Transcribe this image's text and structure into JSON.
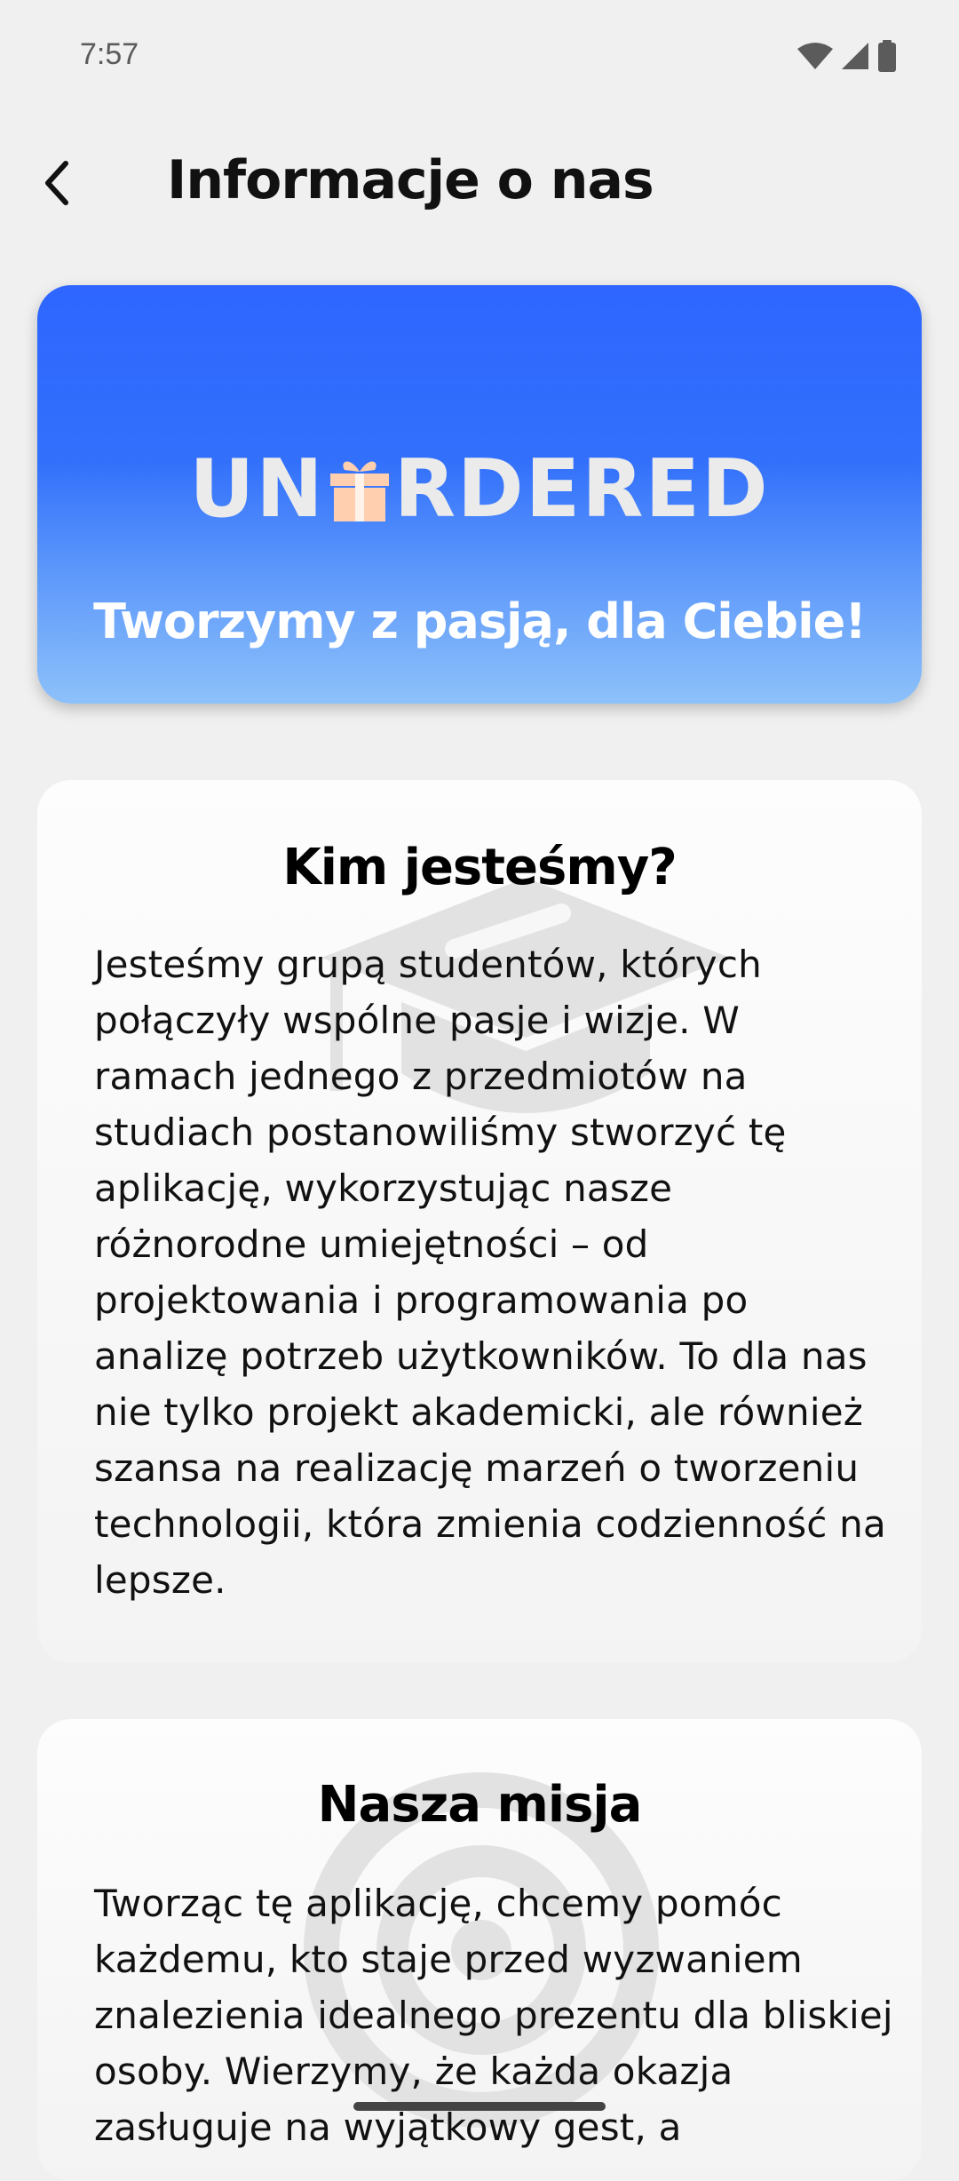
{
  "status_bar": {
    "time": "7:57",
    "icons": [
      "wifi-icon",
      "signal-icon",
      "battery-icon"
    ]
  },
  "app_bar": {
    "back_icon": "back-arrow-icon",
    "title": "Informacje o nas"
  },
  "hero": {
    "logo_text_left": "UN",
    "logo_text_right": "RDERED",
    "logo_icon": "gift-icon",
    "slogan": "Tworzymy z pasją, dla Ciebie!",
    "colors": {
      "gradient_top": "#2e66ff",
      "gradient_bottom": "#8dc1fa",
      "gift": "#ffcfb0"
    }
  },
  "sections": [
    {
      "title": "Kim jesteśmy?",
      "watermark_icon": "graduation-cap-icon",
      "body": "Jesteśmy grupą studentów, których połączyły wspólne pasje i wizje. W ramach jednego z przedmiotów na studiach postanowiliśmy stworzyć tę aplikację, wykorzystując nasze różnorodne umiejętności – od projektowania i programowania po analizę potrzeb użytkowników. To dla nas nie tylko projekt akademicki, ale również szansa na realizację marzeń o tworzeniu technologii, która zmienia codzienność na lepsze."
    },
    {
      "title": "Nasza misja",
      "watermark_icon": "target-icon",
      "body": "Tworząc tę aplikację, chcemy pomóc każdemu, kto staje przed wyzwaniem znalezienia idealnego prezentu dla bliskiej osoby. Wierzymy, że każda okazja zasługuje na wyjątkowy gest, a"
    }
  ]
}
